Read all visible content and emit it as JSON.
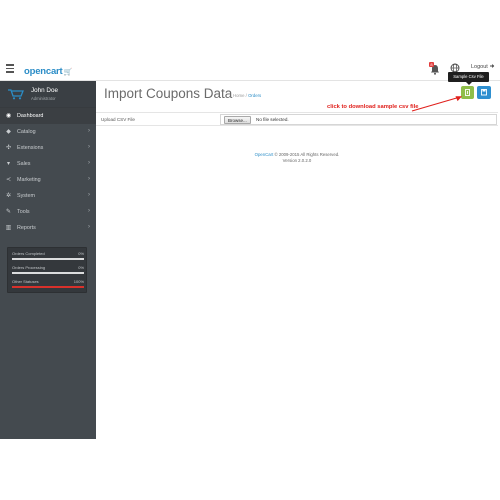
{
  "header": {
    "logo_text": "opencart",
    "notification_count": "8",
    "logout_label": "Logout"
  },
  "profile": {
    "name": "John Doe",
    "role": "Administrator"
  },
  "sidebar": {
    "items": [
      {
        "label": "Dashboard",
        "icon": "dashboard-icon",
        "active": true,
        "has_children": false
      },
      {
        "label": "Catalog",
        "icon": "tag-icon",
        "active": false,
        "has_children": true
      },
      {
        "label": "Extensions",
        "icon": "puzzle-icon",
        "active": false,
        "has_children": true
      },
      {
        "label": "Sales",
        "icon": "cart-icon",
        "active": false,
        "has_children": true
      },
      {
        "label": "Marketing",
        "icon": "share-icon",
        "active": false,
        "has_children": true
      },
      {
        "label": "System",
        "icon": "gear-icon",
        "active": false,
        "has_children": true
      },
      {
        "label": "Tools",
        "icon": "wrench-icon",
        "active": false,
        "has_children": true
      },
      {
        "label": "Reports",
        "icon": "bar-chart-icon",
        "active": false,
        "has_children": true
      }
    ]
  },
  "stats": [
    {
      "label": "Orders Completed",
      "value": "0%",
      "fraction": 0,
      "color": "#ffffff"
    },
    {
      "label": "Orders Processing",
      "value": "0%",
      "fraction": 0,
      "color": "#ffffff"
    },
    {
      "label": "Other Statuses",
      "value": "100%",
      "fraction": 1,
      "color": "#d9312b"
    }
  ],
  "page": {
    "title": "Import Coupons Data",
    "breadcrumb": [
      "Home",
      "Orders"
    ],
    "tooltip": "Sample Csv File",
    "annotation": "click to download sample csv file"
  },
  "form": {
    "upload_label": "Upload CSV File",
    "browse_label": "Browse...",
    "file_status": "No file selected."
  },
  "footer": {
    "brand": "OpenCart",
    "copyright": "© 2009-2015 All Rights Reserved.",
    "version": "Version 2.0.2.0"
  },
  "colors": {
    "accent": "#2b8dc7",
    "sidebar_bg": "#444a4f",
    "download_button": "#8fbe4a",
    "save_button": "#2e8fd0",
    "annotation": "#e0201c"
  }
}
